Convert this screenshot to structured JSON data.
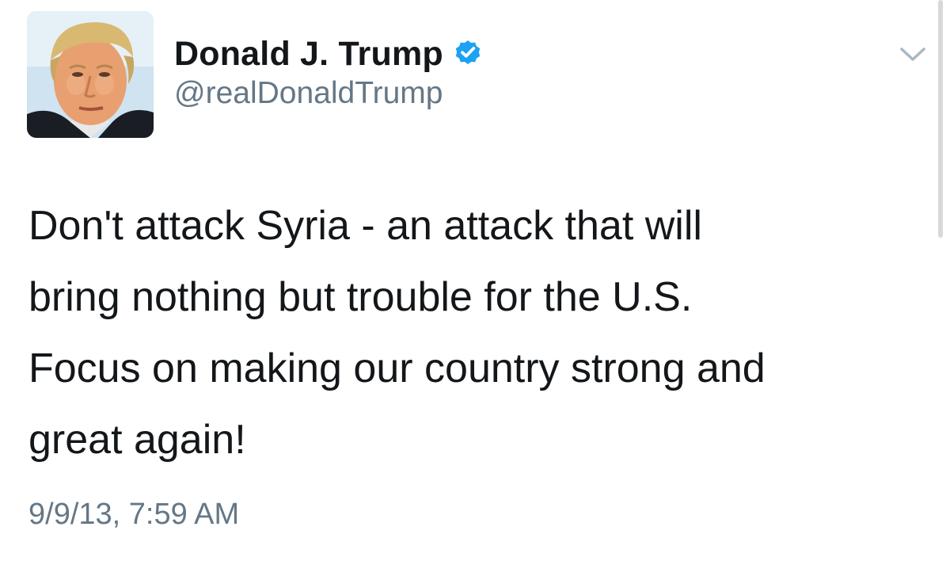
{
  "profile": {
    "display_name": "Donald J. Trump",
    "handle": "@realDonaldTrump",
    "verified": true,
    "avatar_icon": "profile-photo",
    "verified_icon": "verified-badge-icon",
    "verified_color": "#1DA1F2"
  },
  "menu": {
    "icon": "chevron-down-icon"
  },
  "tweet": {
    "text": "Don't attack Syria - an attack that will\nbring nothing but trouble for the U.S.\nFocus on making our country strong and\ngreat again!",
    "timestamp": "9/9/13, 7:59 AM"
  },
  "colors": {
    "text": "#14171A",
    "secondary": "#657786",
    "background": "#FFFFFF"
  }
}
